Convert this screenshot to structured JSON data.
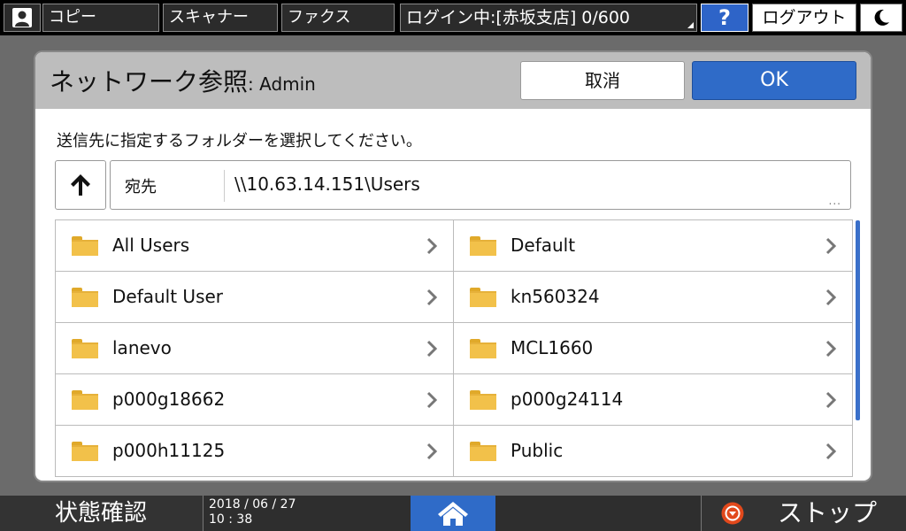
{
  "topbar": {
    "user_icon": "user-icon",
    "copy_label": "コピー",
    "scanner_label": "スキャナー",
    "fax_label": "ファクス",
    "login_status": "ログイン中:[赤坂支店] 0/600",
    "help_label": "?",
    "logout_label": "ログアウト",
    "sleep_icon": "moon-icon"
  },
  "dialog": {
    "title": "ネットワーク参照",
    "title_sub": ": Admin",
    "cancel_label": "取消",
    "ok_label": "OK",
    "instruction": "送信先に指定するフォルダーを選択してください。",
    "up_icon": "arrow-up-icon",
    "path_label": "宛先",
    "path_value": "\\\\10.63.14.151\\Users",
    "path_more": "...",
    "folders": [
      {
        "name": "All Users"
      },
      {
        "name": "Default"
      },
      {
        "name": "Default User"
      },
      {
        "name": "kn560324"
      },
      {
        "name": "lanevo"
      },
      {
        "name": "MCL1660"
      },
      {
        "name": "p000g18662"
      },
      {
        "name": "p000g24114"
      },
      {
        "name": "p000h11125"
      },
      {
        "name": "Public"
      }
    ]
  },
  "bottombar": {
    "status_label": "状態確認",
    "date": "2018 / 06 / 27",
    "time": "10 : 38",
    "home_icon": "home-icon",
    "stop_label": "ストップ"
  },
  "colors": {
    "accent_blue": "#2f6bc8",
    "header_gray": "#bdbdbd",
    "folder_yellow": "#f2c14a",
    "stop_orange": "#e2491c"
  }
}
